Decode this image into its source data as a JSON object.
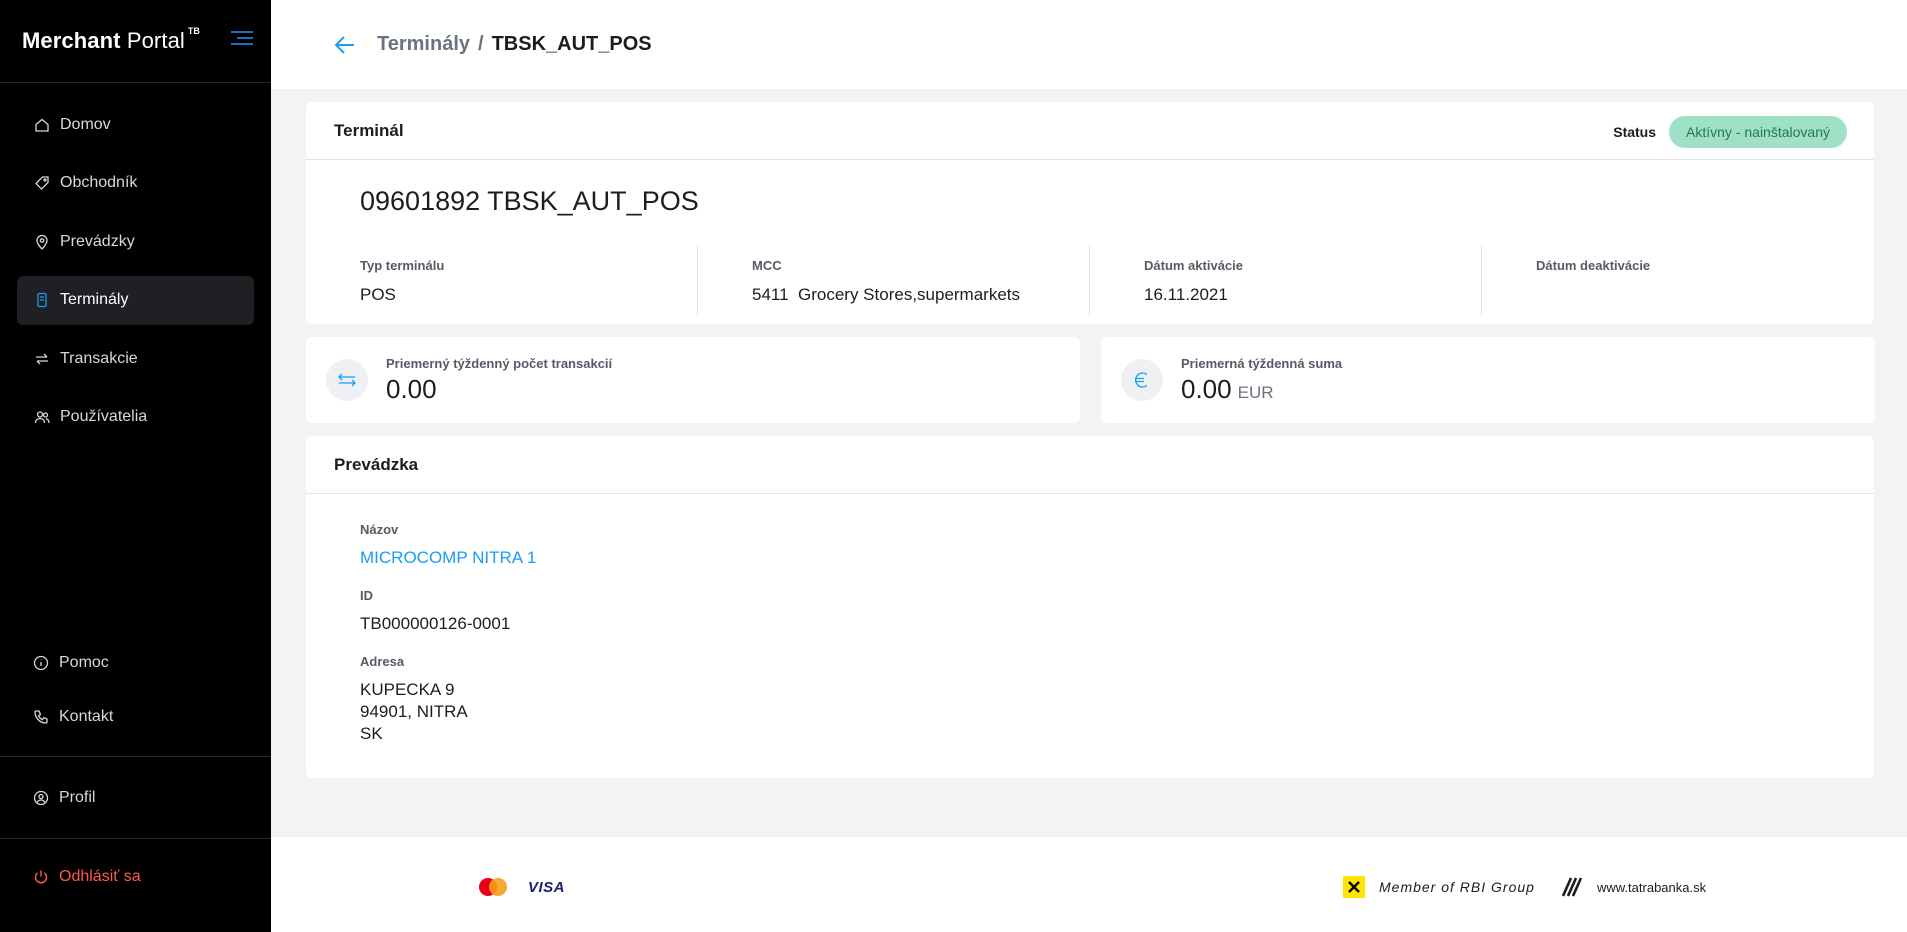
{
  "brand": {
    "title_bold": "Merchant",
    "title_light": "Portal",
    "sup": "TB"
  },
  "nav": {
    "items": [
      {
        "label": "Domov"
      },
      {
        "label": "Obchodník"
      },
      {
        "label": "Prevádzky"
      },
      {
        "label": "Terminály"
      },
      {
        "label": "Transakcie"
      },
      {
        "label": "Používatelia"
      }
    ],
    "help": "Pomoc",
    "contact": "Kontakt",
    "profile": "Profil",
    "logout": "Odhlásiť sa"
  },
  "header": {
    "breadcrumb_parent": "Terminály",
    "separator": "/",
    "breadcrumb_current": "TBSK_AUT_POS"
  },
  "terminal": {
    "title": "Terminál",
    "status_label": "Status",
    "status_value": "Aktívny - nainštalovaný",
    "name": "09601892 TBSK_AUT_POS",
    "fields": {
      "type_label": "Typ terminálu",
      "type_value": "POS",
      "mcc_label": "MCC",
      "mcc_value": "5411  Grocery Stores,supermarkets",
      "activation_label": "Dátum aktivácie",
      "activation_value": "16.11.2021",
      "deactivation_label": "Dátum deaktivácie",
      "deactivation_value": ""
    }
  },
  "stats": {
    "tx_label": "Priemerný týždenný počet transakcií",
    "tx_value": "0.00",
    "sum_label": "Priemerná týždenná suma",
    "sum_value": "0.00",
    "sum_unit": "EUR"
  },
  "shop": {
    "title": "Prevádzka",
    "name_label": "Názov",
    "name_value": "MICROCOMP NITRA 1",
    "id_label": "ID",
    "id_value": "TB000000126-0001",
    "address_label": "Adresa",
    "address_line1": "KUPECKA 9",
    "address_line2": "94901, NITRA",
    "address_line3": "SK"
  },
  "footer": {
    "visa": "VISA",
    "rbi": "Member of RBI Group",
    "tatra": "www.tatrabanka.sk"
  },
  "colors": {
    "accent": "#1a9cf0",
    "logout": "#ff5a4f",
    "badge_bg": "#9fe0c7",
    "badge_text": "#1f7a55"
  }
}
